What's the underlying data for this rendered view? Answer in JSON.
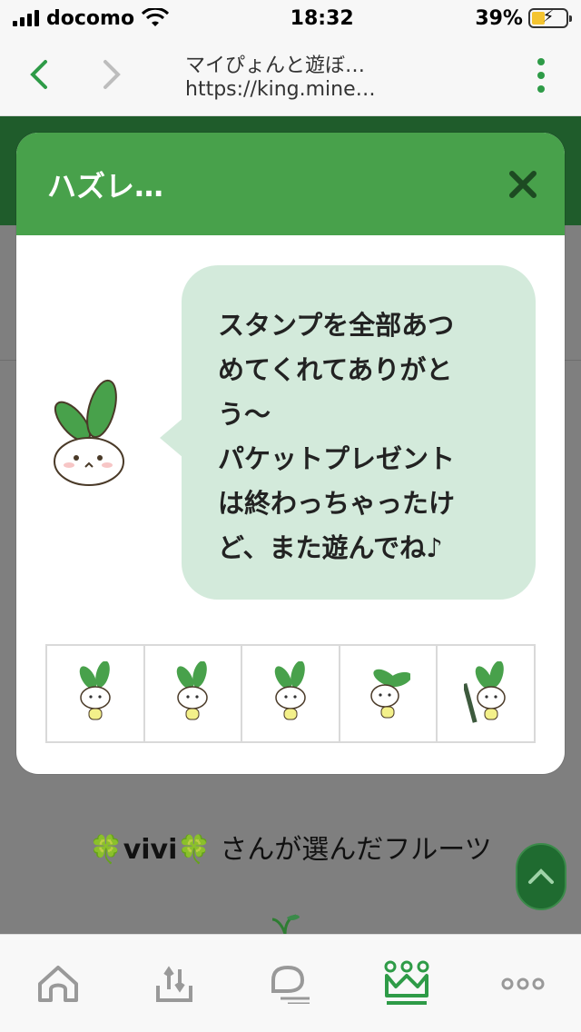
{
  "status_bar": {
    "carrier": "docomo",
    "time": "18:32",
    "battery": "39%",
    "battery_level": 0.39
  },
  "browser": {
    "page_title": "マイぴょんと遊ぼ…",
    "url": "https://king.mine…",
    "back_icon": "chevron-left-icon",
    "forward_icon": "chevron-right-icon",
    "menu_icon": "kebab-menu-icon"
  },
  "modal": {
    "title": "ハズレ…",
    "close_icon": "close-icon",
    "message": "スタンプを全部あつ\nめてくれてありがと\nう〜\nパケットプレゼント\nは終わっちゃったけ\nど、また遊んでね♪",
    "stamps": [
      {
        "name": "rabbit-stamp-1"
      },
      {
        "name": "rabbit-stamp-2"
      },
      {
        "name": "rabbit-stamp-3"
      },
      {
        "name": "rabbit-stamp-4"
      },
      {
        "name": "rabbit-stamp-5"
      }
    ]
  },
  "page": {
    "clover_left": "🍀",
    "user_name": "vivi",
    "clover_right": "🍀",
    "fruit_label": " さんが選んだフルーツ",
    "scroll_top_icon": "chevron-up-icon"
  },
  "tab_bar": {
    "tabs": [
      {
        "icon": "home-icon",
        "active": false
      },
      {
        "icon": "download-icon",
        "active": false
      },
      {
        "icon": "chat-icon",
        "active": false
      },
      {
        "icon": "crown-icon",
        "active": true
      },
      {
        "icon": "more-icon",
        "active": false
      }
    ]
  },
  "colors": {
    "accent": "#48a14b",
    "dark_green": "#1f5c2b",
    "bubble": "#d3eadb"
  }
}
